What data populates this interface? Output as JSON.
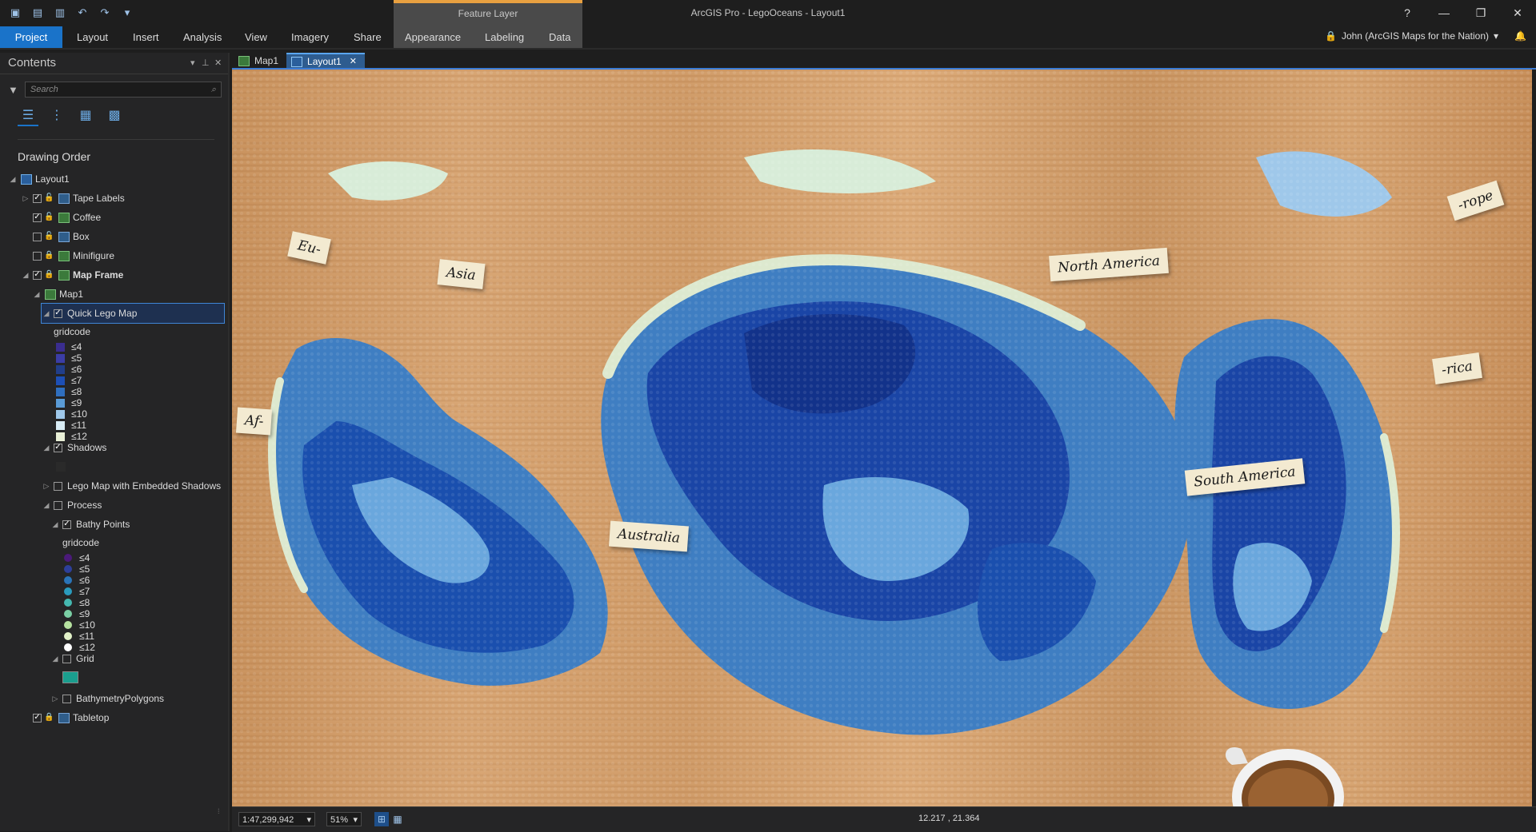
{
  "window": {
    "title": "ArcGIS Pro - LegoOceans - Layout1",
    "context_tab_group": "Feature Layer",
    "controls": {
      "help": "?",
      "minimize": "—",
      "restore": "❐",
      "close": "✕"
    }
  },
  "quick_access": {
    "icons": [
      "project-icon",
      "open-icon",
      "save-icon",
      "undo-icon",
      "redo-icon",
      "customize-icon"
    ]
  },
  "ribbon": {
    "tabs": [
      "Project",
      "Layout",
      "Insert",
      "Analysis",
      "View",
      "Imagery",
      "Share",
      "Appearance",
      "Labeling",
      "Data"
    ],
    "active": "Project"
  },
  "user": {
    "name": "John (ArcGIS Maps for the Nation)",
    "caret": "▾"
  },
  "contents": {
    "title": "Contents",
    "search_placeholder": "Search",
    "heading": "Drawing Order",
    "items": {
      "layout": "Layout1",
      "tape_labels": "Tape Labels",
      "coffee": "Coffee",
      "box": "Box",
      "minifigure": "Minifigure",
      "map_frame": "Map Frame",
      "map": "Map1",
      "quick_lego": "Quick Lego Map",
      "gridcode1": "gridcode",
      "shadows": "Shadows",
      "lego_embedded": "Lego Map with Embedded Shadows",
      "process": "Process",
      "bathy_points": "Bathy Points",
      "gridcode2": "gridcode",
      "grid": "Grid",
      "bathy_polygons": "BathymetryPolygons",
      "tabletop": "Tabletop"
    },
    "legend1": [
      {
        "label": "≤4",
        "color": "#3a2d8f"
      },
      {
        "label": "≤5",
        "color": "#3b3da6"
      },
      {
        "label": "≤6",
        "color": "#213e8a"
      },
      {
        "label": "≤7",
        "color": "#1d4fb5"
      },
      {
        "label": "≤8",
        "color": "#2f6fbf"
      },
      {
        "label": "≤9",
        "color": "#5a9bd6"
      },
      {
        "label": "≤10",
        "color": "#9fc8ea"
      },
      {
        "label": "≤11",
        "color": "#d8ecf5"
      },
      {
        "label": "≤12",
        "color": "#e8efd6"
      }
    ],
    "legend2": [
      {
        "label": "≤4",
        "color": "#4b1a7a"
      },
      {
        "label": "≤5",
        "color": "#2d3f9a"
      },
      {
        "label": "≤6",
        "color": "#2a74b8"
      },
      {
        "label": "≤7",
        "color": "#2a9bbd"
      },
      {
        "label": "≤8",
        "color": "#45b8b0"
      },
      {
        "label": "≤9",
        "color": "#7acfa4"
      },
      {
        "label": "≤10",
        "color": "#b6e2a0"
      },
      {
        "label": "≤11",
        "color": "#e2f2c8"
      },
      {
        "label": "≤12",
        "color": "#ffffff"
      }
    ],
    "shadow_color": "#2a2a2a",
    "grid_color": "#1a9e8e"
  },
  "view_tabs": [
    {
      "label": "Map1",
      "active": false
    },
    {
      "label": "Layout1",
      "active": true,
      "close": "✕"
    }
  ],
  "map_labels": {
    "eu": "Eu-",
    "asia": "Asia",
    "north_america": "North America",
    "rope": "-rope",
    "rica": "-rica",
    "af": "Af-",
    "south_america": "South America",
    "australia": "Australia"
  },
  "status": {
    "scale": "1:47,299,942",
    "zoom": "51%",
    "coords": "12.217 , 21.364"
  },
  "colors": {
    "accent": "#1a73c9",
    "context_accent": "#e8a040"
  }
}
